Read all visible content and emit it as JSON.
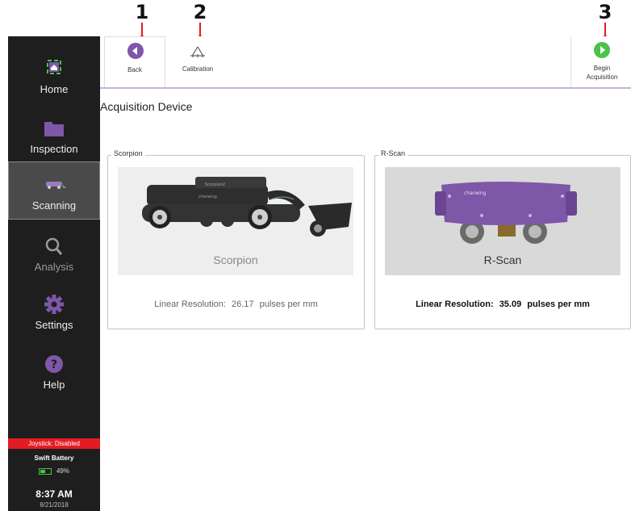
{
  "callouts": [
    "1",
    "2",
    "3"
  ],
  "sidebar": {
    "items": [
      {
        "label": "Home",
        "icon": "home-icon"
      },
      {
        "label": "Inspection",
        "icon": "folder-icon"
      },
      {
        "label": "Scanning",
        "icon": "scanner-icon"
      },
      {
        "label": "Analysis",
        "icon": "magnifier-icon"
      },
      {
        "label": "Settings",
        "icon": "gear-icon"
      },
      {
        "label": "Help",
        "icon": "question-icon"
      }
    ],
    "joystick": "Joystick: Disabled",
    "battery_title": "Swift Battery",
    "battery_level": "49%",
    "time": "8:37 AM",
    "date": "8/21/2018"
  },
  "toolbar": {
    "back_label": "Back",
    "calibration_label": "Calibration",
    "begin_label_line1": "Begin",
    "begin_label_line2": "Acquisition"
  },
  "main": {
    "title": "Acquisition Device",
    "devices": [
      {
        "legend": "Scorpion",
        "image_caption": "Scorpion",
        "resolution_label": "Linear Resolution:",
        "resolution_value": "26.17",
        "resolution_unit": "pulses per mm",
        "brand": "Scorpion2",
        "logo": "charwing"
      },
      {
        "legend": "R-Scan",
        "image_caption": "R-Scan",
        "resolution_label": "Linear Resolution:",
        "resolution_value": "35.09",
        "resolution_unit": "pulses per mm",
        "logo": "charwing"
      }
    ]
  },
  "colors": {
    "accent_red": "#e31b23",
    "purple": "#7e57a8",
    "green": "#4cc24a",
    "sidebar": "#1e1e1e"
  }
}
